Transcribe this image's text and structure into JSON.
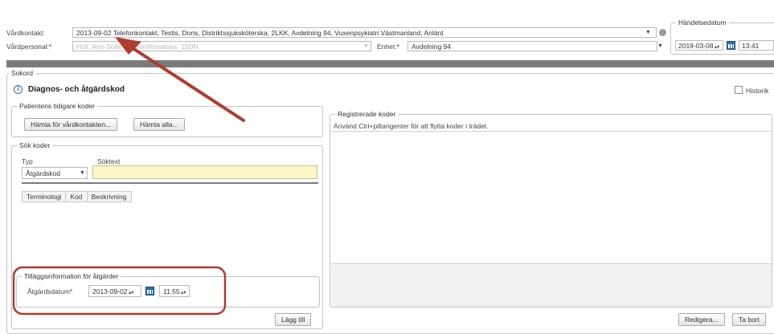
{
  "header": {
    "vardkontakt_label": "Vårdkontakt:",
    "vardkontakt_value": "2013-09-02 Telefonkontakt, Testis, Doris, Distriktssjuksköterska, 2LKK, Avdelning 94, Vuxenpsykiatri Västmanland, Anlänt",
    "vardpersonal_label": "Vårdpersonal:*",
    "vardpersonal_value": "Hult, Ann-Sofie, Systemförvaltare, 15DN",
    "enhet_label": "Enhet:*",
    "enhet_value": "Avdelning 94",
    "handelsedatum_legend": "Händelsedatum",
    "handelsedatum_date": "2019-03-08",
    "handelsedatum_time": "13:41"
  },
  "sokord": {
    "legend": "Sokord",
    "title": "Diagnos- och åtgärdskod",
    "historik_label": "Historik"
  },
  "patient_codes": {
    "legend": "Patientens tidigare koder",
    "fetch_contact_button": "Hämta för vårdkontakten...",
    "fetch_all_button": "Hämta alla..."
  },
  "search": {
    "legend": "Sök koder",
    "type_label": "Typ",
    "searchtext_label": "Söktext",
    "type_value": "Åtgärdskod",
    "searchtext_value": "",
    "columns": [
      "Terminologi",
      "Kod",
      "Beskrivning"
    ]
  },
  "additional_info": {
    "legend": "Tilläggsinformation för åtgärder",
    "date_label": "Åtgärdsdatum*",
    "date_value": "2013-09-02",
    "time_value": "11:55",
    "add_button": "Lägg till"
  },
  "registered": {
    "legend": "Registrerade koder",
    "hint": "Använd Ctrl+piltangenter för att flytta koder i trädet.",
    "edit_button": "Redigera...",
    "remove_button": "Ta bort"
  },
  "colors": {
    "accent": "#1d6fc0",
    "divider_bar": "#7b7b7b",
    "search_field_bg": "#fdf7c7",
    "annotation_red": "#b03c2f"
  }
}
